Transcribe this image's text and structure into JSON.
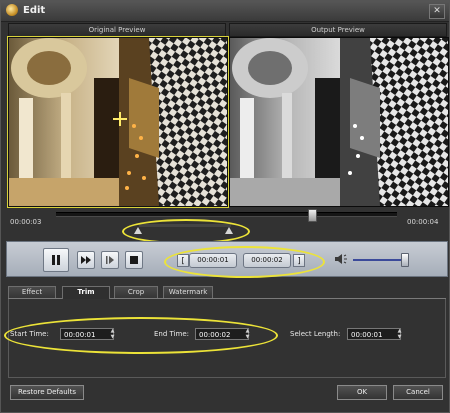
{
  "window": {
    "title": "Edit",
    "close_glyph": "✕"
  },
  "panes": {
    "original_label": "Original Preview",
    "output_label": "Output Preview"
  },
  "timeline": {
    "start_time": "00:00:03",
    "end_time": "00:00:04",
    "seek_position": 0.75
  },
  "playback": {
    "trim_start": "00:00:01",
    "trim_end": "00:00:02",
    "volume_level": 0.9,
    "icons": [
      "pause-icon",
      "fast-forward-icon",
      "next-frame-icon",
      "stop-icon",
      "set-start-bracket-icon",
      "set-end-bracket-icon",
      "speaker-icon"
    ]
  },
  "tabs": [
    {
      "label": "Effect"
    },
    {
      "label": "Trim"
    },
    {
      "label": "Crop"
    },
    {
      "label": "Watermark"
    }
  ],
  "active_tab": "Trim",
  "trim": {
    "start_label": "Start Time:",
    "start_value": "00:00:01",
    "end_label": "End Time:",
    "end_value": "00:00:02",
    "length_label": "Select Length:",
    "length_value": "00:00:01"
  },
  "buttons": {
    "restore": "Restore Defaults",
    "ok": "OK",
    "cancel": "Cancel"
  },
  "colors": {
    "highlight": "#ece338",
    "window_bg": "#323232",
    "control_bar": "#b6bdc7"
  }
}
